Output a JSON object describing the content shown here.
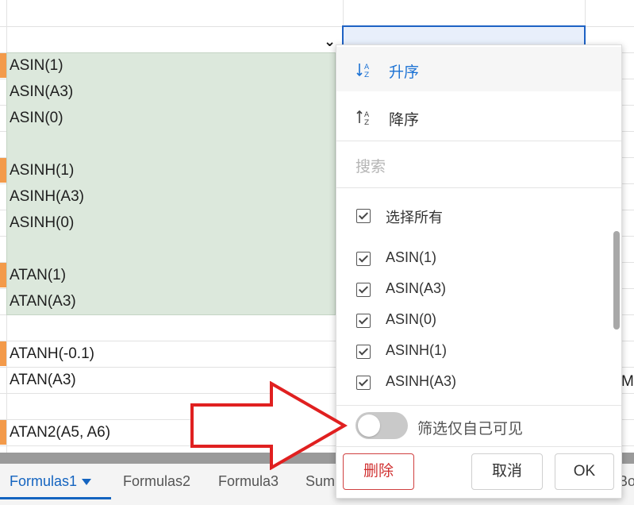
{
  "sheet": {
    "rows": [
      {
        "label": "ASIN(1)",
        "flag": true
      },
      {
        "label": "ASIN(A3)",
        "flag": false
      },
      {
        "label": "ASIN(0)",
        "flag": false
      },
      {
        "label": "ASINH(1)",
        "flag": true
      },
      {
        "label": "ASINH(A3)",
        "flag": false
      },
      {
        "label": "ASINH(0)",
        "flag": false
      },
      {
        "label": "ATAN(1)",
        "flag": true
      },
      {
        "label": "ATAN(A3)",
        "flag": false
      },
      {
        "label": "ATANH(-0.1)",
        "flag": true
      },
      {
        "label": "ATAN(A3)",
        "flag": false
      },
      {
        "label": "ATAN2(A5, A6)",
        "flag": true
      }
    ],
    "edge_text": "M",
    "highlight_color": "#dce8dc",
    "flag_color": "#f39a4a",
    "selection_color": "#1e62c4"
  },
  "tabs": [
    {
      "label": "Formulas1",
      "active": true
    },
    {
      "label": "Formulas2",
      "active": false
    },
    {
      "label": "Formula3",
      "active": false
    },
    {
      "label": "Sum",
      "active": false
    },
    {
      "label": "Bo",
      "active": false
    }
  ],
  "filter_panel": {
    "sort_asc": "升序",
    "sort_desc": "降序",
    "search_placeholder": "搜索",
    "select_all": "选择所有",
    "items": [
      {
        "label": "ASIN(1)",
        "checked": true
      },
      {
        "label": "ASIN(A3)",
        "checked": true
      },
      {
        "label": "ASIN(0)",
        "checked": true
      },
      {
        "label": "ASINH(1)",
        "checked": true
      },
      {
        "label": "ASINH(A3)",
        "checked": true
      }
    ],
    "toggle_label": "筛选仅自己可见",
    "toggle_on": false,
    "delete_label": "删除",
    "cancel_label": "取消",
    "ok_label": "OK",
    "accent_color": "#1c72d4",
    "danger_color": "#d03030"
  },
  "annotation": {
    "arrow_color": "#e02020"
  }
}
